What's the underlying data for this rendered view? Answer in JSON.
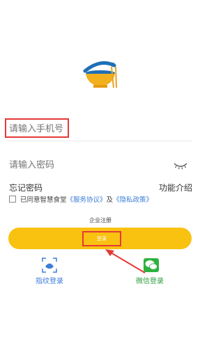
{
  "form": {
    "phone_placeholder": "请输入手机号",
    "password_placeholder": "请输入密码",
    "forgot_password": "忘记密码",
    "feature_intro": "功能介绍"
  },
  "agreement": {
    "prefix": "已同意智慧食堂",
    "service_link": "《服务协议》",
    "and": "及",
    "privacy_link": "《隐私政策》"
  },
  "enterprise_register": "企业注册",
  "login_button": "登录",
  "alt_login": {
    "fingerprint": "指纹登录",
    "wechat": "微信登录"
  },
  "colors": {
    "primary": "#f9c211",
    "link": "#3b7dd8",
    "wechat": "#2e9e3c",
    "highlight": "#e53935"
  },
  "icons": [
    "canteen-logo-icon",
    "eye-closed-icon",
    "fingerprint-icon",
    "wechat-icon",
    "red-arrow-icon"
  ]
}
